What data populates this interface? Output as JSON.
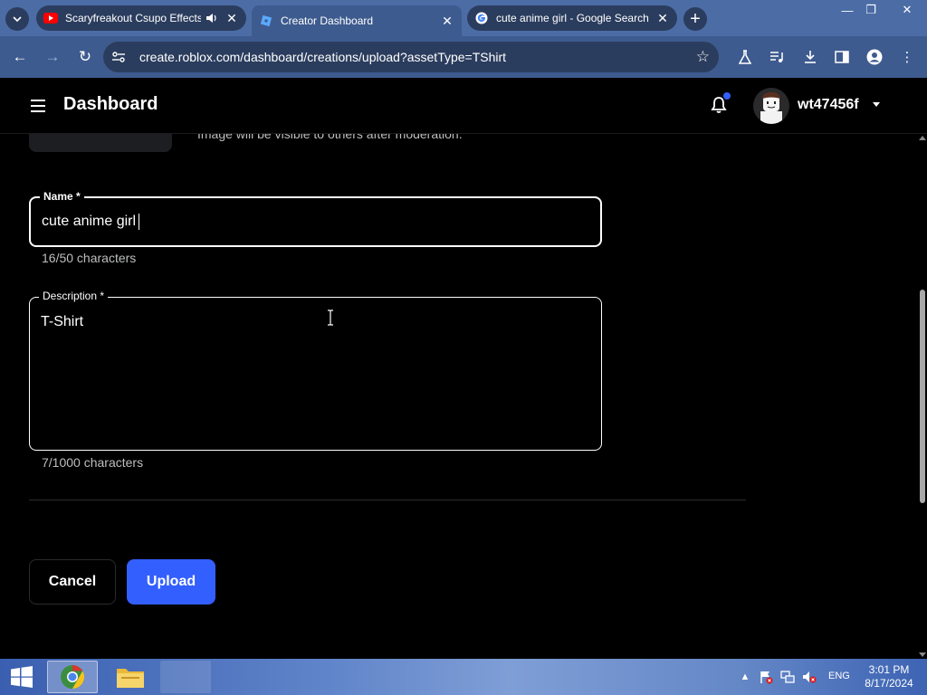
{
  "browser": {
    "tabs": [
      {
        "title": "Scaryfreakout Csupo Effects",
        "favicon": "youtube-icon",
        "audio": true,
        "active": false
      },
      {
        "title": "Creator Dashboard",
        "favicon": "roblox-icon",
        "audio": false,
        "active": true
      },
      {
        "title": "cute anime girl - Google Search",
        "favicon": "google-icon",
        "audio": false,
        "active": false
      }
    ],
    "url": "create.roblox.com/dashboard/creations/upload?assetType=TShirt",
    "colors": {
      "tabstrip": "#4c6ca6",
      "toolbar": "#3e5b8f"
    }
  },
  "header": {
    "title": "Dashboard",
    "username": "wt47456f",
    "has_notification": true
  },
  "upload_form": {
    "moderation_note": "Image will be visible to others after moderation.",
    "name_field": {
      "label": "Name *",
      "value": "cute anime girl",
      "count": "16/50 characters"
    },
    "description_field": {
      "label": "Description *",
      "value": "T-Shirt",
      "count": "7/1000 characters"
    },
    "cancel_label": "Cancel",
    "upload_label": "Upload",
    "accent_color": "#335fff"
  },
  "taskbar": {
    "language": "ENG",
    "time": "3:01 PM",
    "date": "8/17/2024"
  }
}
